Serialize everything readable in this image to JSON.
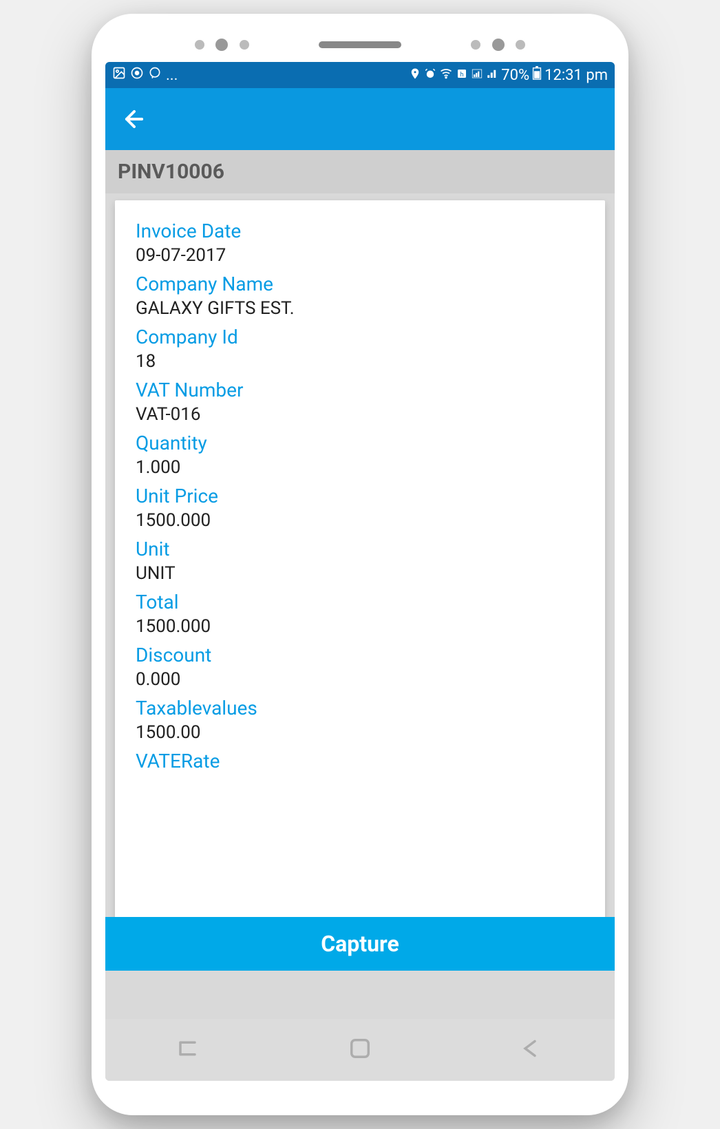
{
  "status_bar": {
    "ellipsis": "...",
    "battery_text": "70%",
    "time": "12:31 pm"
  },
  "page": {
    "title": "PINV10006",
    "capture_button": "Capture"
  },
  "fields": [
    {
      "label": "Invoice Date",
      "value": "09-07-2017"
    },
    {
      "label": "Company Name",
      "value": "GALAXY GIFTS EST."
    },
    {
      "label": "Company Id",
      "value": "18"
    },
    {
      "label": "VAT Number",
      "value": "VAT-016"
    },
    {
      "label": "Quantity",
      "value": "1.000"
    },
    {
      "label": "Unit Price",
      "value": "1500.000"
    },
    {
      "label": "Unit",
      "value": "UNIT"
    },
    {
      "label": "Total",
      "value": "1500.000"
    },
    {
      "label": "Discount",
      "value": "0.000"
    },
    {
      "label": "Taxablevalues",
      "value": "1500.00"
    },
    {
      "label": "VATERate",
      "value": ""
    }
  ]
}
